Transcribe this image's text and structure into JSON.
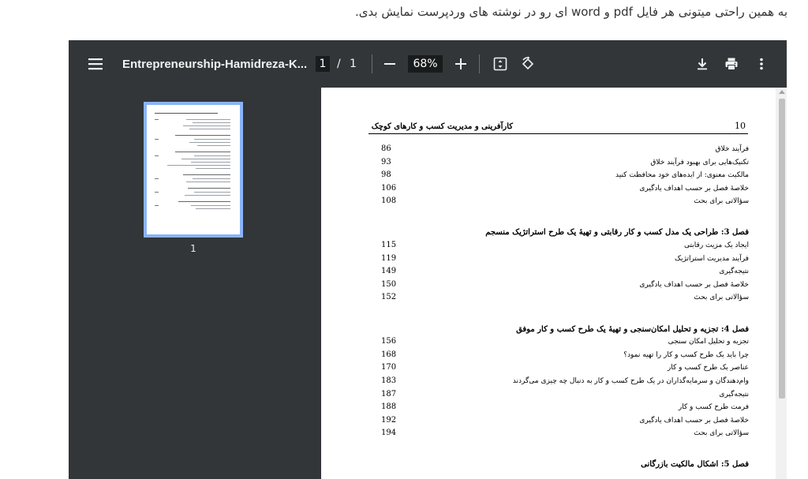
{
  "caption": "به همین راحتی میتونی هر فایل pdf و word ای رو در نوشته های وردپرست نمایش بدی.",
  "toolbar": {
    "title": "Entrepreneurship-Hamidreza-K...",
    "page_current": "1",
    "page_sep": "/",
    "page_total": "1",
    "zoom": "68%",
    "icons": [
      "menu-icon",
      "zoom-out-icon",
      "zoom-in-icon",
      "fit-to-page-icon",
      "rotate-icon",
      "download-icon",
      "print-icon",
      "more-vert-icon"
    ]
  },
  "sidebar": {
    "thumbnail_label": "1"
  },
  "document": {
    "header_title": "کارآفرینی و مدیریت کسب و کارهای کوچک",
    "page_number": "10",
    "entries": [
      {
        "text": "فرآیند خلاق",
        "page": "86"
      },
      {
        "text": "تکنیک‌هایی برای بهبود فرآیند خلاق",
        "page": "93"
      },
      {
        "text": "مالکیت معنوی: از ایده‌های خود محافظت کنید",
        "page": "98"
      },
      {
        "text": "خلاصهٔ فصل بر حسب اهداف یادگیری",
        "page": "106"
      },
      {
        "text": "سؤالاتی برای بحث",
        "page": "108"
      },
      {
        "chapter": "فصل 3: طراحی یک مدل کسب و کار رقابتی و تهیهٔ یک طرح استراتژیک منسجم"
      },
      {
        "text": "ایجاد یک مزیت رقابتی",
        "page": "115"
      },
      {
        "text": "فرآیند مدیریت استراتژیک",
        "page": "119"
      },
      {
        "text": "نتیجه‌گیری",
        "page": "149"
      },
      {
        "text": "خلاصهٔ فصل بر حسب اهداف یادگیری",
        "page": "150"
      },
      {
        "text": "سؤالاتی برای بحث",
        "page": "152"
      },
      {
        "chapter": "فصل 4: تجزیه و تحلیل امکان‌سنجی و تهیهٔ یک طرح کسب و کار موفق"
      },
      {
        "text": "تجزیه و تحلیل امکان سنجی",
        "page": "156"
      },
      {
        "text": "چرا باید یک طرح کسب و کار را تهیه نمود؟",
        "page": "168"
      },
      {
        "text": "عناصر یک طرح کسب و کار",
        "page": "170"
      },
      {
        "text": "وام‌دهندگان و سرمایه‌گذاران در یک طرح کسب و کار به دنبال چه چیزی می‌گردند",
        "page": "183"
      },
      {
        "text": "نتیجه‌گیری",
        "page": "187"
      },
      {
        "text": "فرمت طرح کسب و کار",
        "page": "188"
      },
      {
        "text": "خلاصهٔ فصل بر حسب اهداف یادگیری",
        "page": "192"
      },
      {
        "text": "سؤالاتی برای بحث",
        "page": "194"
      },
      {
        "chapter": "فصل 5: اشکال مالکیت بازرگانی"
      }
    ]
  }
}
